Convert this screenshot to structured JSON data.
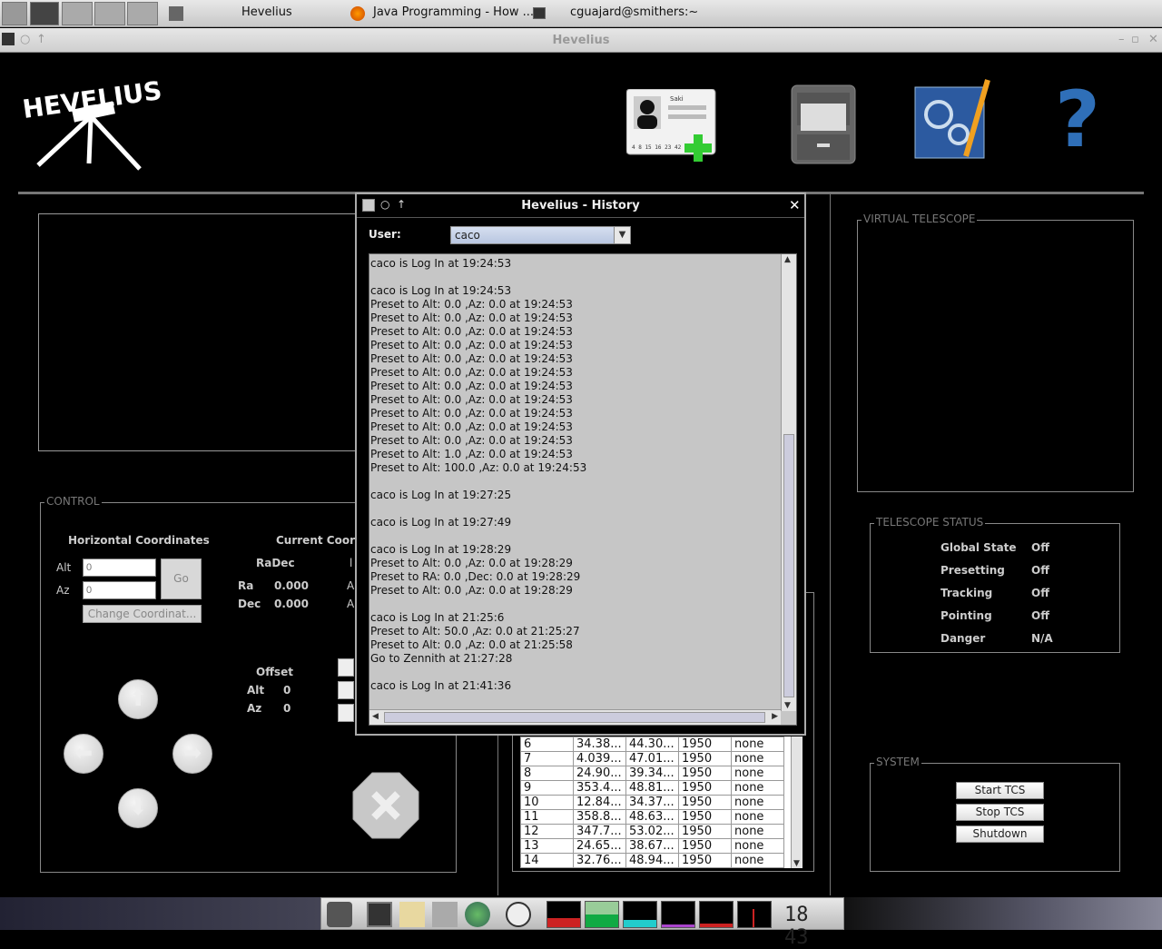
{
  "taskbar": {
    "tasks": [
      {
        "label": "Hevelius"
      },
      {
        "label": "Java Programming - How ..."
      },
      {
        "label": "cguajard@smithers:~"
      }
    ]
  },
  "window": {
    "title": "Hevelius"
  },
  "logo": {
    "text": "HEVELIUS"
  },
  "toolbar": {
    "user_card_name": "Saki",
    "user_card_code": "4 8 15 16 23 42",
    "help_glyph": "?"
  },
  "control": {
    "legend": "CONTROL",
    "horizontal_title": "Horizontal Coordinates",
    "alt_label": "Alt",
    "az_label": "Az",
    "alt_placeholder": "0",
    "az_placeholder": "0",
    "go_label": "Go",
    "change_label": "Change Coordinat...",
    "current_title": "Current Coord",
    "radec_label": "RaDec",
    "ra_label": "Ra",
    "ra_value": "0.000",
    "dec_label": "Dec",
    "dec_value": "0.000",
    "col2_hint": "l",
    "a1": "A",
    "a2": "A",
    "offset_title": "Offset",
    "offset_alt_label": "Alt",
    "offset_alt_value": "0",
    "offset_az_label": "Az",
    "offset_az_value": "0"
  },
  "virtual_telescope": {
    "legend": "VIRTUAL TELESCOPE"
  },
  "telescope_status": {
    "legend": "TELESCOPE STATUS",
    "rows": [
      {
        "label": "Global State",
        "value": "Off"
      },
      {
        "label": "Presetting",
        "value": "Off"
      },
      {
        "label": "Tracking",
        "value": "Off"
      },
      {
        "label": "Pointing",
        "value": "Off"
      },
      {
        "label": "Danger",
        "value": "N/A"
      }
    ]
  },
  "system": {
    "legend": "SYSTEM",
    "start_label": "Start TCS",
    "stop_label": "Stop TCS",
    "shutdown_label": "Shutdown"
  },
  "history_dialog": {
    "title": "Hevelius - History",
    "user_label": "User:",
    "user_value": "caco",
    "lines": [
      "caco is Log In at 19:24:53",
      "",
      "caco is Log In at 19:24:53",
      "Preset to Alt: 0.0 ,Az: 0.0 at 19:24:53",
      "Preset to Alt: 0.0 ,Az: 0.0 at 19:24:53",
      "Preset to Alt: 0.0 ,Az: 0.0 at 19:24:53",
      "Preset to Alt: 0.0 ,Az: 0.0 at 19:24:53",
      "Preset to Alt: 0.0 ,Az: 0.0 at 19:24:53",
      "Preset to Alt: 0.0 ,Az: 0.0 at 19:24:53",
      "Preset to Alt: 0.0 ,Az: 0.0 at 19:24:53",
      "Preset to Alt: 0.0 ,Az: 0.0 at 19:24:53",
      "Preset to Alt: 0.0 ,Az: 0.0 at 19:24:53",
      "Preset to Alt: 0.0 ,Az: 0.0 at 19:24:53",
      "Preset to Alt: 0.0 ,Az: 0.0 at 19:24:53",
      "Preset to Alt: 1.0 ,Az: 0.0 at 19:24:53",
      "Preset to Alt: 100.0 ,Az: 0.0 at 19:24:53",
      "",
      "caco is Log In at 19:27:25",
      "",
      "caco is Log In at 19:27:49",
      "",
      "caco is Log In at 19:28:29",
      "Preset to Alt: 0.0 ,Az: 0.0 at 19:28:29",
      "Preset to RA: 0.0 ,Dec: 0.0 at 19:28:29",
      "Preset to Alt: 0.0 ,Az: 0.0 at 19:28:29",
      "",
      "caco is Log In at 21:25:6",
      "Preset to Alt: 50.0 ,Az: 0.0 at 21:25:27",
      "Preset to Alt: 0.0 ,Az: 0.0 at 21:25:58",
      "Go to Zennith at 21:27:28",
      "",
      "caco is Log In at 21:41:36"
    ]
  },
  "object_table": {
    "rows": [
      [
        "6",
        "34.38...",
        "44.30...",
        "1950",
        "none"
      ],
      [
        "7",
        "4.039...",
        "47.01...",
        "1950",
        "none"
      ],
      [
        "8",
        "24.90...",
        "39.34...",
        "1950",
        "none"
      ],
      [
        "9",
        "353.4...",
        "48.81...",
        "1950",
        "none"
      ],
      [
        "10",
        "12.84...",
        "34.37...",
        "1950",
        "none"
      ],
      [
        "11",
        "358.8...",
        "48.63...",
        "1950",
        "none"
      ],
      [
        "12",
        "347.7...",
        "53.02...",
        "1950",
        "none"
      ],
      [
        "13",
        "24.65...",
        "38.67...",
        "1950",
        "none"
      ],
      [
        "14",
        "32.76...",
        "48.94...",
        "1950",
        "none"
      ]
    ]
  },
  "dock": {
    "clock": "18 43"
  }
}
